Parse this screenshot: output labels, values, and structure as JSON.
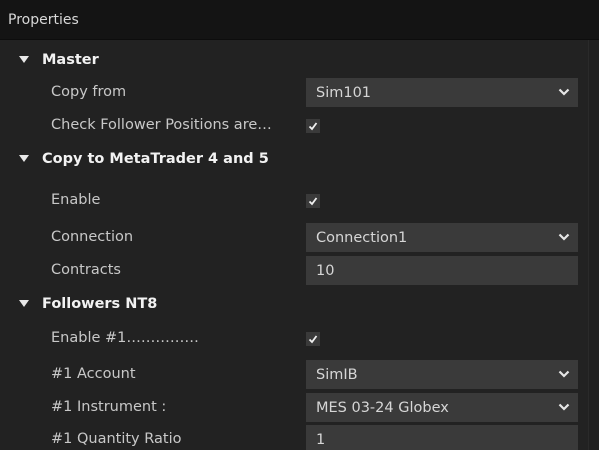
{
  "panel": {
    "title": "Properties"
  },
  "categories": {
    "master": {
      "label": "Master",
      "copy_from": {
        "label": "Copy from",
        "value": "Sim101"
      },
      "check_follower": {
        "label": "Check Follower Positions are…",
        "checked": true
      }
    },
    "metatrader": {
      "label": "Copy to MetaTrader 4 and 5",
      "enable": {
        "label": "Enable",
        "checked": true
      },
      "connection": {
        "label": "Connection",
        "value": "Connection1"
      },
      "contracts": {
        "label": "Contracts",
        "value": "10"
      }
    },
    "followers": {
      "label": "Followers NT8",
      "enable1": {
        "label": "Enable #1……………",
        "checked": true
      },
      "account1": {
        "label": "#1 Account",
        "value": "SimIB"
      },
      "instrument1": {
        "label": "#1 Instrument :",
        "value": "MES 03-24 Globex"
      },
      "quantity_ratio1": {
        "label": "#1 Quantity Ratio",
        "value": "1"
      }
    }
  },
  "colors": {
    "background": "#222222",
    "header": "#141414",
    "field": "#3a3a3a",
    "text": "#c8c8c8"
  }
}
